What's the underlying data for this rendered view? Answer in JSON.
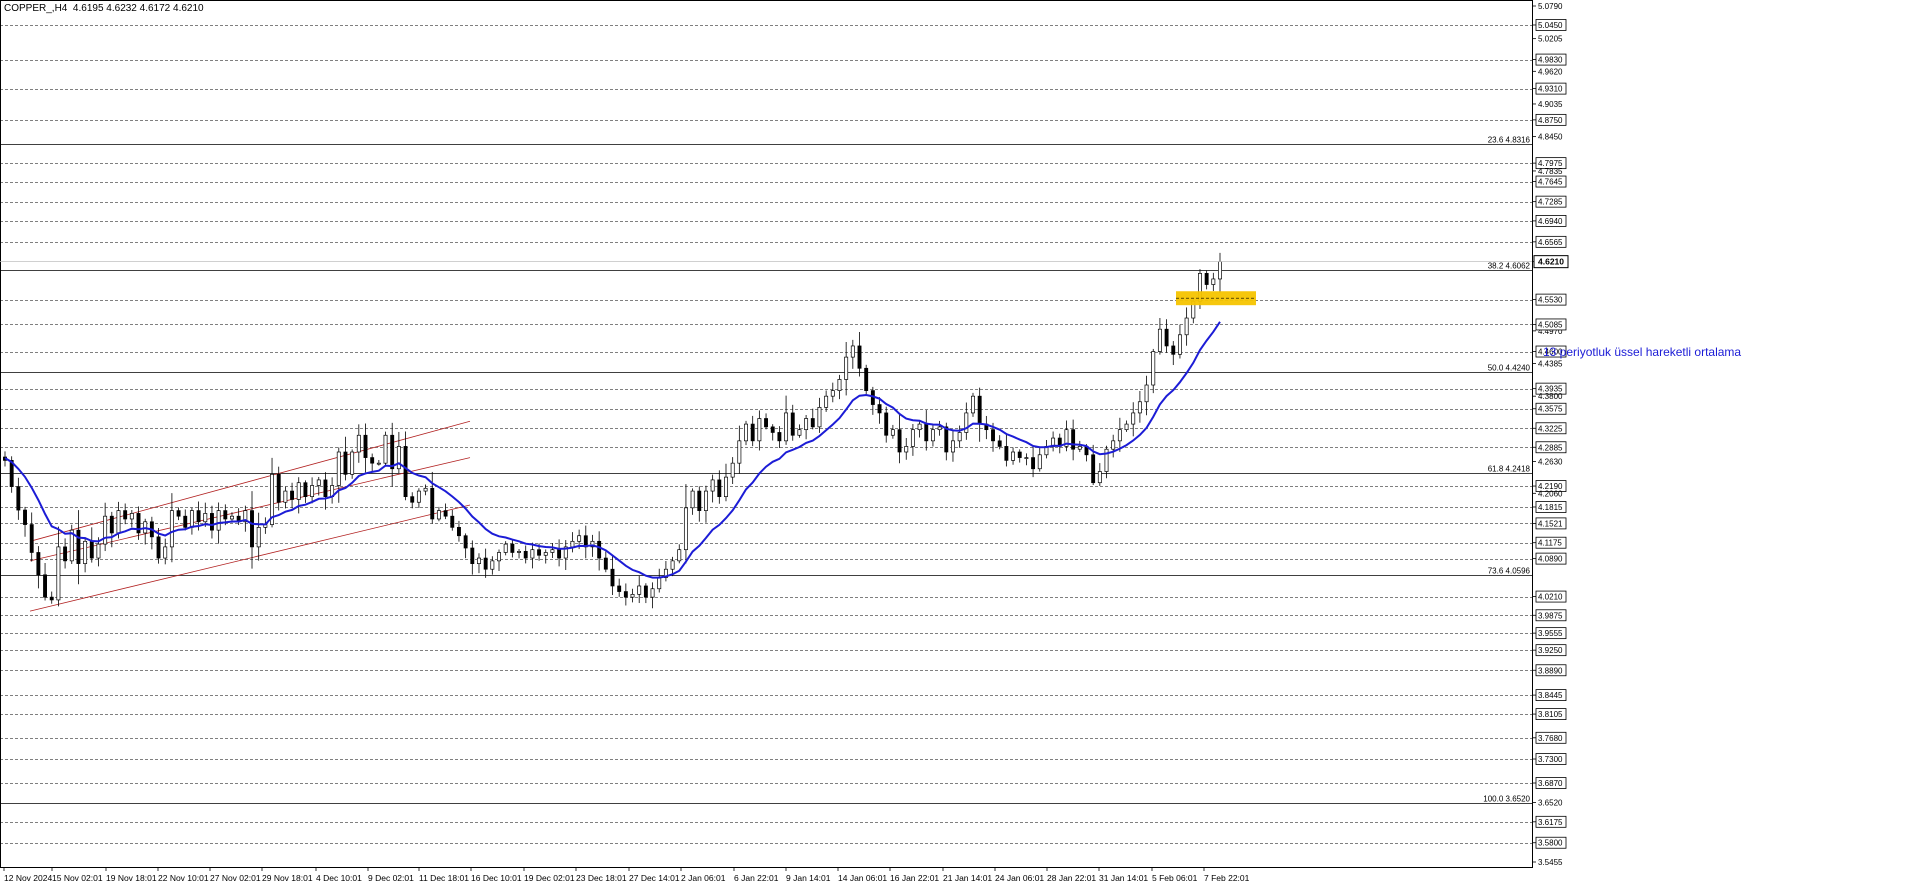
{
  "header": {
    "symbol": "COPPER_,H4",
    "ohlc": "4.6195 4.6232 4.6172 4.6210"
  },
  "annotation": "13 periyotluk üssel hareketli ortalama",
  "colors": {
    "candle": "#000000",
    "ema": "#1c1cd6",
    "channel": "#b22222",
    "zone": "#f5c400",
    "grid": "#000000"
  },
  "chart_data": {
    "type": "candlestick",
    "ylim": [
      3.545,
      5.079
    ],
    "yticks": [
      "5.0790",
      "5.0450",
      "5.0205",
      "4.9830",
      "4.9620",
      "4.9310",
      "4.9035",
      "4.8750",
      "4.8450",
      "4.7975",
      "4.7835",
      "4.7645",
      "4.7285",
      "4.6940",
      "4.6565",
      "4.6210",
      "4.5530",
      "4.4970",
      "4.5085",
      "4.4600",
      "4.4385",
      "4.3935",
      "4.3800",
      "4.3575",
      "4.3225",
      "4.2885",
      "4.2630",
      "4.2190",
      "4.2060",
      "4.1815",
      "4.1521",
      "4.1175",
      "4.0890",
      "4.0210",
      "3.9875",
      "3.9555",
      "3.9250",
      "3.8890",
      "3.8445",
      "3.8105",
      "3.7680",
      "3.7300",
      "3.6870",
      "3.6520",
      "3.6175",
      "3.5800",
      "3.5455"
    ],
    "dashed_levels": [
      5.045,
      4.983,
      4.931,
      4.875,
      4.7975,
      4.7645,
      4.7285,
      4.694,
      4.6565,
      4.553,
      4.5085,
      4.46,
      4.3935,
      4.3575,
      4.3225,
      4.2885,
      4.219,
      4.1815,
      4.1521,
      4.1175,
      4.089,
      4.021,
      3.9875,
      3.9555,
      3.925,
      3.889,
      3.8445,
      3.8105,
      3.768,
      3.73,
      3.687,
      3.6175,
      3.58
    ],
    "fib_levels": [
      {
        "label": "23.6 4.8316",
        "value": 4.8316
      },
      {
        "label": "38.2 4.6062",
        "value": 4.6062
      },
      {
        "label": "50.0 4.4240",
        "value": 4.424
      },
      {
        "label": "61.8 4.2418",
        "value": 4.2418
      },
      {
        "label": "73.6 4.0596",
        "value": 4.0596
      },
      {
        "label": "100.0 3.6520",
        "value": 3.652
      }
    ],
    "current_price": "4.6210",
    "current_value": 4.621,
    "xticks": [
      "12 Nov 2024",
      "15 Nov 02:01",
      "19 Nov 18:01",
      "22 Nov 10:01",
      "27 Nov 02:01",
      "29 Nov 18:01",
      "4 Dec 10:01",
      "9 Dec 02:01",
      "11 Dec 18:01",
      "16 Dec 10:01",
      "19 Dec 02:01",
      "23 Dec 18:01",
      "27 Dec 14:01",
      "2 Jan 06:01",
      "6 Jan 22:01",
      "9 Jan 14:01",
      "14 Jan 06:01",
      "16 Jan 22:01",
      "21 Jan 14:01",
      "24 Jan 06:01",
      "28 Jan 22:01",
      "31 Jan 14:01",
      "5 Feb 06:01",
      "7 Feb 22:01"
    ],
    "path_close": [
      4.265,
      4.218,
      4.176,
      4.15,
      4.1,
      4.06,
      4.02,
      4.015,
      4.11,
      4.085,
      4.14,
      4.08,
      4.12,
      4.09,
      4.115,
      4.165,
      4.135,
      4.175,
      4.16,
      4.17,
      4.135,
      4.155,
      4.128,
      4.09,
      4.11,
      4.175,
      4.165,
      4.145,
      4.175,
      4.155,
      4.17,
      4.14,
      4.175,
      4.16,
      4.165,
      4.155,
      4.175,
      4.11,
      4.145,
      4.15,
      4.24,
      4.19,
      4.21,
      4.195,
      4.225,
      4.2,
      4.22,
      4.23,
      4.2,
      4.22,
      4.28,
      4.24,
      4.28,
      4.31,
      4.27,
      4.26,
      4.26,
      4.31,
      4.25,
      4.29,
      4.2,
      4.19,
      4.21,
      4.215,
      4.16,
      4.175,
      4.165,
      4.145,
      4.13,
      4.108,
      4.08,
      4.09,
      4.07,
      4.085,
      4.1,
      4.115,
      4.1,
      4.102,
      4.09,
      4.105,
      4.095,
      4.1,
      4.105,
      4.09,
      4.11,
      4.12,
      4.13,
      4.11,
      4.12,
      4.09,
      4.07,
      4.04,
      4.03,
      4.02,
      4.025,
      4.04,
      4.02,
      4.035,
      4.055,
      4.07,
      4.085,
      4.105,
      4.18,
      4.21,
      4.175,
      4.21,
      4.23,
      4.2,
      4.235,
      4.26,
      4.3,
      4.33,
      4.3,
      4.34,
      4.325,
      4.315,
      4.3,
      4.35,
      4.31,
      4.32,
      4.34,
      4.325,
      4.36,
      4.38,
      4.39,
      4.41,
      4.45,
      4.47,
      4.43,
      4.39,
      4.365,
      4.35,
      4.31,
      4.32,
      4.28,
      4.29,
      4.32,
      4.33,
      4.3,
      4.32,
      4.325,
      4.28,
      4.3,
      4.315,
      4.35,
      4.38,
      4.33,
      4.32,
      4.3,
      4.29,
      4.265,
      4.28,
      4.27,
      4.27,
      4.25,
      4.275,
      4.29,
      4.305,
      4.29,
      4.32,
      4.285,
      4.29,
      4.275,
      4.225,
      4.245,
      4.285,
      4.3,
      4.32,
      4.33,
      4.35,
      4.37,
      4.4,
      4.46,
      4.5,
      4.47,
      4.455,
      4.49,
      4.52,
      4.55,
      4.6,
      4.58,
      4.59,
      4.621
    ],
    "ema_label": "13 periyotluk üssel hareketli ortalama"
  }
}
